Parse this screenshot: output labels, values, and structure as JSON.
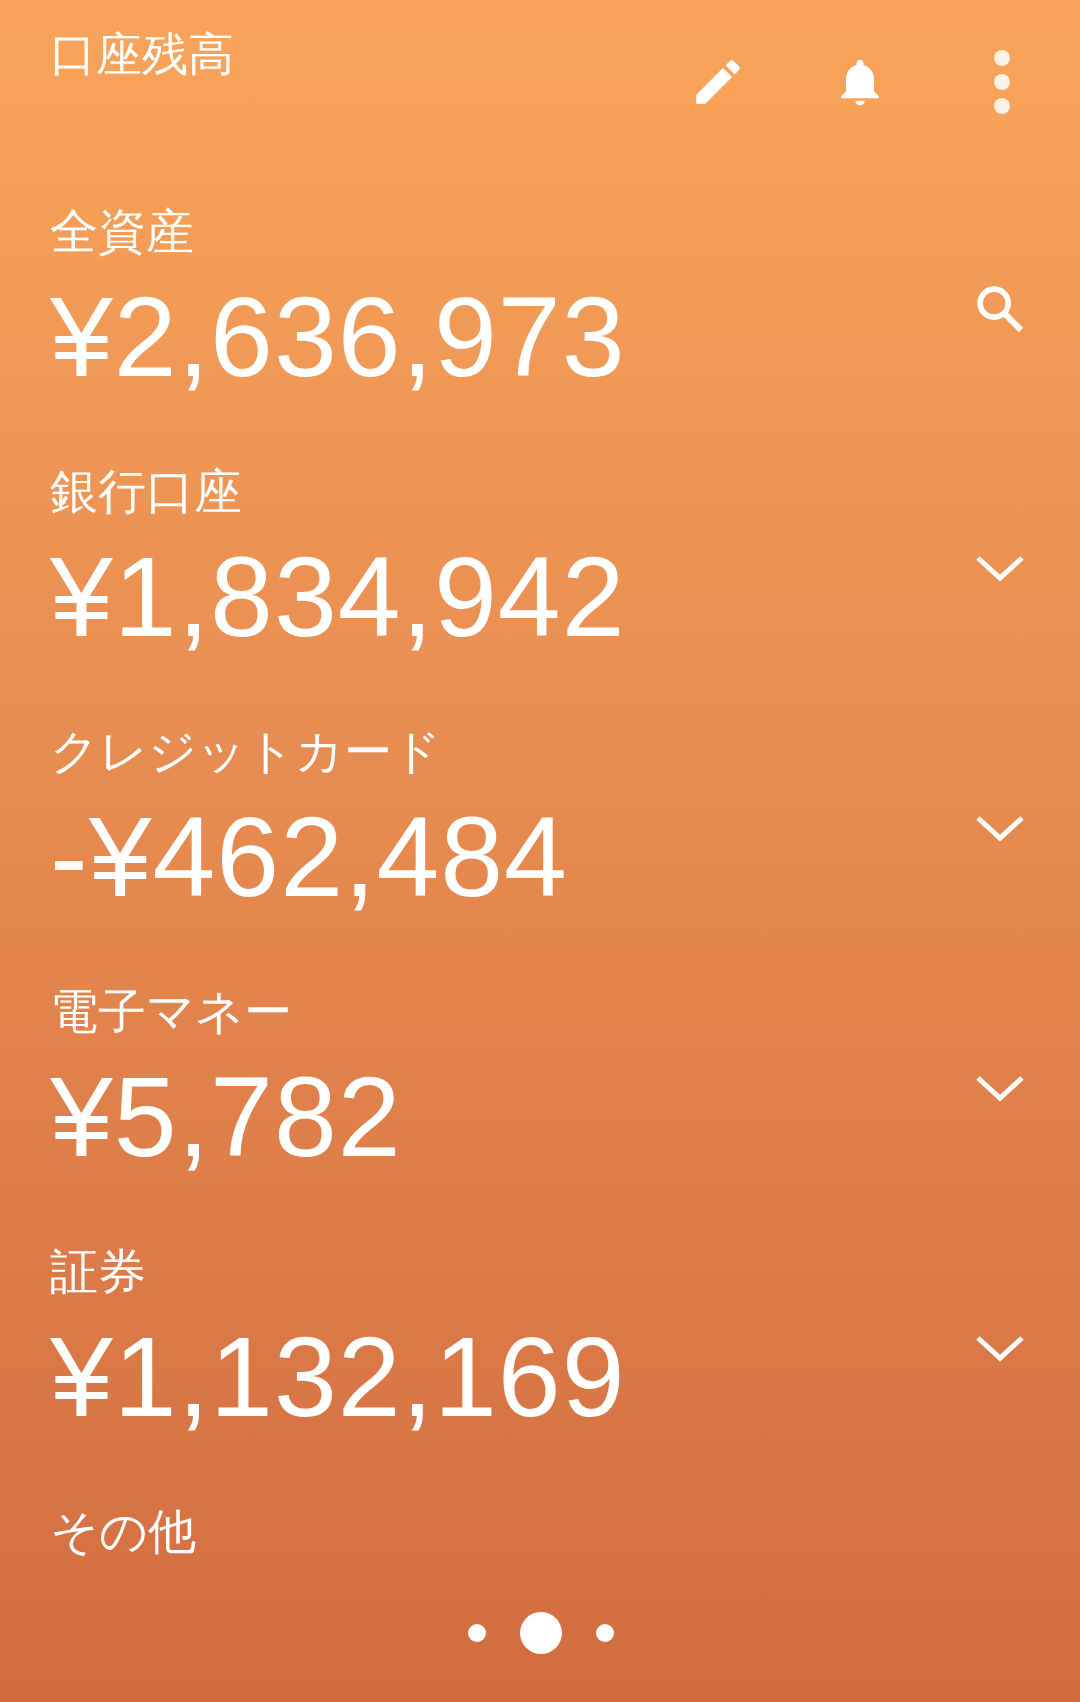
{
  "header": {
    "title": "口座残高"
  },
  "accounts": [
    {
      "label": "全資産",
      "amount": "¥2,636,973",
      "kind": "search"
    },
    {
      "label": "銀行口座",
      "amount": "¥1,834,942",
      "kind": "expand"
    },
    {
      "label": "クレジットカード",
      "amount": "-¥462,484",
      "kind": "expand"
    },
    {
      "label": "電子マネー",
      "amount": "¥5,782",
      "kind": "expand"
    },
    {
      "label": "証券",
      "amount": "¥1,132,169",
      "kind": "expand"
    },
    {
      "label": "その他",
      "kind": "plain"
    }
  ],
  "pages": [
    {
      "selected": false
    },
    {
      "selected": true
    },
    {
      "selected": false
    }
  ]
}
